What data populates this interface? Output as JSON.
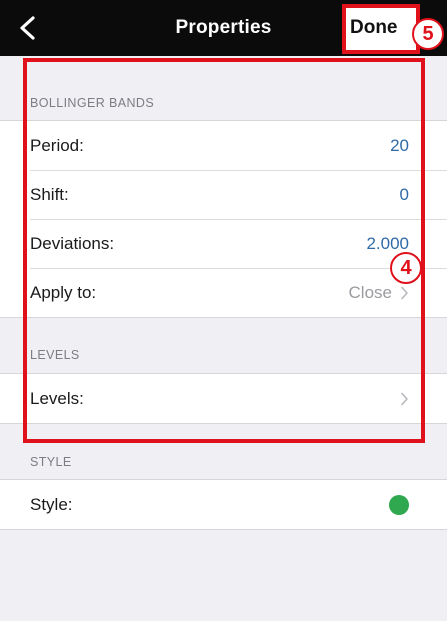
{
  "navbar": {
    "title": "Properties",
    "done_label": "Done"
  },
  "callouts": {
    "done_number": "5",
    "main_number": "4"
  },
  "sections": {
    "bollinger": {
      "header": "BOLLINGER BANDS",
      "period_label": "Period:",
      "period_value": "20",
      "shift_label": "Shift:",
      "shift_value": "0",
      "deviations_label": "Deviations:",
      "deviations_value": "2.000",
      "apply_label": "Apply to:",
      "apply_value": "Close"
    },
    "levels": {
      "header": "LEVELS",
      "levels_label": "Levels:"
    },
    "style": {
      "header": "STYLE",
      "style_label": "Style:",
      "style_color": "#2fa84f"
    }
  },
  "colors": {
    "navbar_bg": "#0b0b0b",
    "highlight": "#e0111a",
    "value_blue": "#2f6aa6"
  },
  "icons": {
    "back": "chevron-left-icon",
    "disclosure": "chevron-right-icon"
  }
}
